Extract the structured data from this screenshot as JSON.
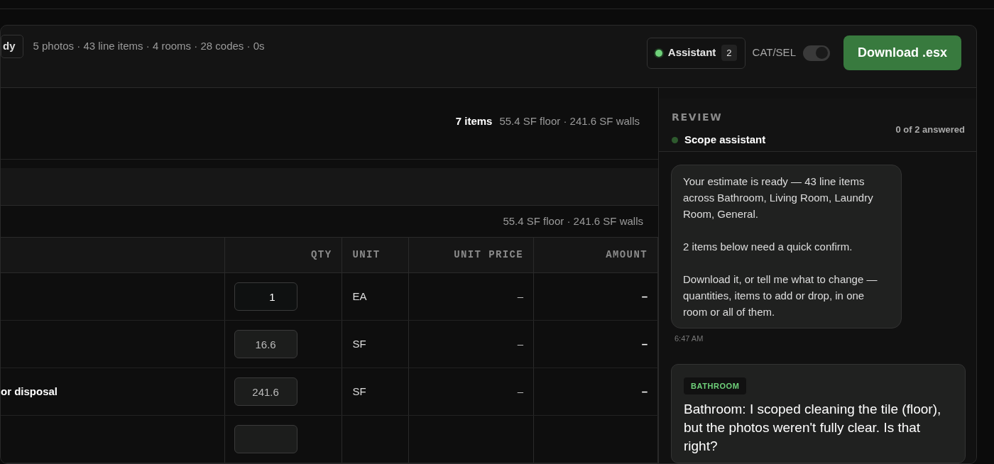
{
  "header": {
    "status_badge": "dy",
    "summary": "5 photos · 43 line items · 4 rooms · 28 codes · 0s",
    "assistant_button": {
      "label": "Assistant",
      "count": "2",
      "online": true
    },
    "toggle": {
      "label": "CAT/SEL",
      "on": true
    },
    "download_button": "Download .esx"
  },
  "room_summary": {
    "count": "7 items",
    "measurements": "55.4 SF floor · 241.6 SF walls"
  },
  "section_measurements": "55.4 SF floor · 241.6 SF walls",
  "table": {
    "columns": [
      "QTY",
      "UNIT",
      "UNIT PRICE",
      "AMOUNT"
    ],
    "rows": [
      {
        "description": "",
        "qty": "1",
        "edited": true,
        "unit": "EA",
        "unit_price": "–",
        "amount": "–"
      },
      {
        "description": "",
        "qty": "16.6",
        "edited": false,
        "unit": "SF",
        "unit_price": "–",
        "amount": "–"
      },
      {
        "description": "or disposal",
        "qty": "241.6",
        "edited": false,
        "unit": "SF",
        "unit_price": "–",
        "amount": "–"
      },
      {
        "description": "",
        "qty": "",
        "edited": false,
        "unit": "",
        "unit_price": "",
        "amount": ""
      }
    ]
  },
  "review": {
    "heading": "REVIEW",
    "title": "Scope assistant",
    "progress": "0 of 2 answered",
    "message": {
      "paragraphs": [
        "Your estimate is ready — 43 line items across Bathroom, Living Room, Laundry Room, General.",
        "2 items below need a quick confirm.",
        "Download it, or tell me what to change — quantities, items to add or drop, in one room or all of them."
      ],
      "time": "6:47 AM"
    },
    "question": {
      "tag": "BATHROOM",
      "text": "Bathroom: I scoped cleaning the tile (floor), but the photos weren't fully clear. Is that right?"
    }
  }
}
